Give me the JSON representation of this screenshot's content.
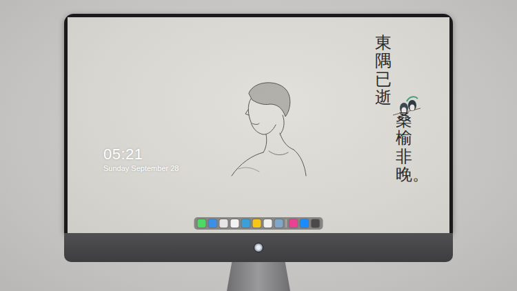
{
  "desktop": {
    "clock": {
      "time": "05:21",
      "date": "Sunday September 28"
    },
    "poem": [
      "東隅已逝",
      "桑榆非晚。"
    ]
  },
  "dock": {
    "items": [
      {
        "color": "#4cd964"
      },
      {
        "color": "#3b8fe8"
      },
      {
        "color": "#e6e6e6"
      },
      {
        "color": "#f2f2f2"
      },
      {
        "color": "#3aa0d9"
      },
      {
        "color": "#f5c518"
      },
      {
        "color": "#f0f0f0"
      },
      {
        "color": "#7ea7c9"
      },
      {
        "color": "#e84393"
      },
      {
        "color": "#1a8cff"
      },
      {
        "color": "#4a4a4a"
      }
    ]
  }
}
